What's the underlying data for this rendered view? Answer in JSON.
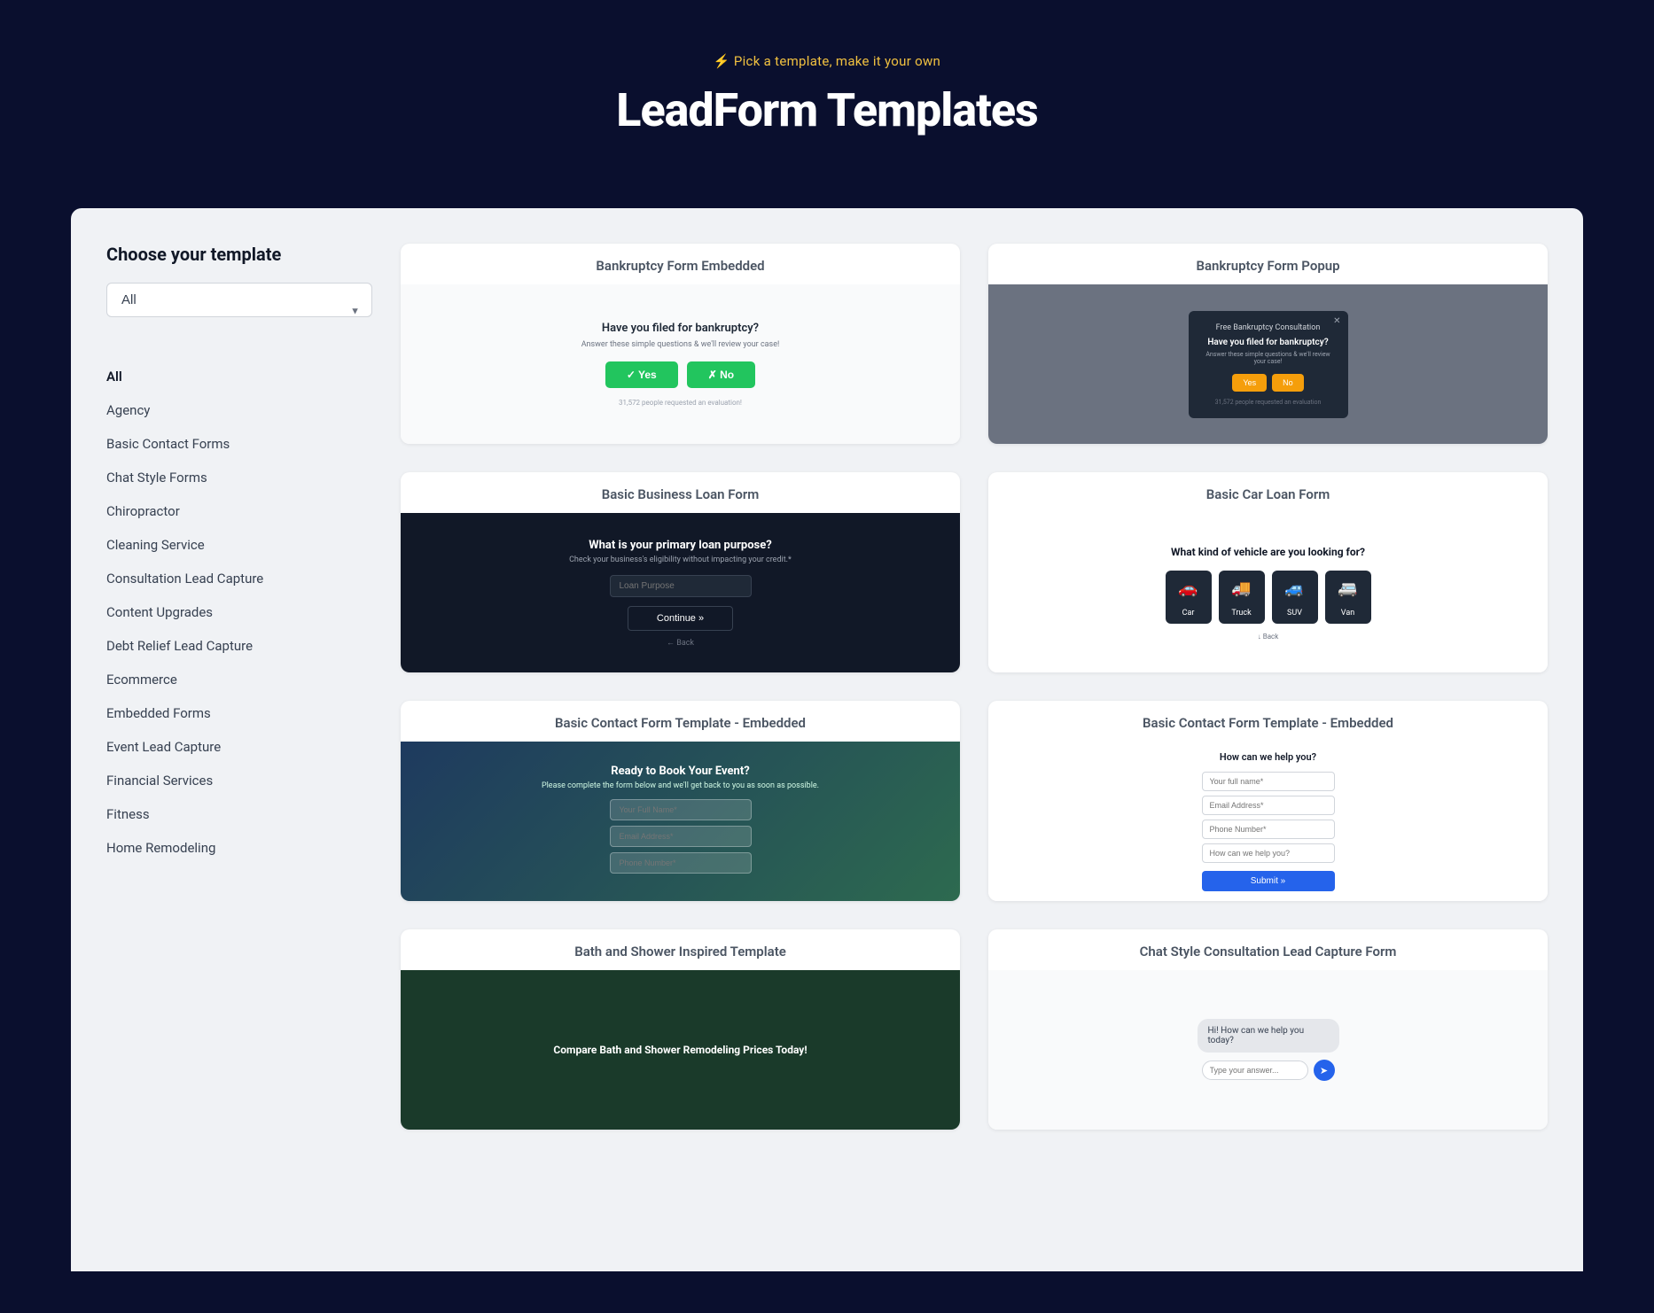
{
  "hero": {
    "subtitle": "⚡ Pick a template, make it your own",
    "title": "LeadForm Templates"
  },
  "sidebar": {
    "title": "Choose your template",
    "dropdown": {
      "value": "All",
      "options": [
        "All",
        "Agency",
        "Basic Contact Forms",
        "Chat Style Forms",
        "Chiropractor",
        "Cleaning Service",
        "Consultation Lead Capture",
        "Content Upgrades",
        "Debt Relief Lead Capture",
        "Ecommerce",
        "Embedded Forms",
        "Event Lead Capture",
        "Financial Services",
        "Fitness",
        "Home Remodeling"
      ]
    },
    "nav_items": [
      {
        "label": "All",
        "active": true
      },
      {
        "label": "Agency",
        "active": false
      },
      {
        "label": "Basic Contact Forms",
        "active": false
      },
      {
        "label": "Chat Style Forms",
        "active": false
      },
      {
        "label": "Chiropractor",
        "active": false
      },
      {
        "label": "Cleaning Service",
        "active": false
      },
      {
        "label": "Consultation Lead Capture",
        "active": false
      },
      {
        "label": "Content Upgrades",
        "active": false
      },
      {
        "label": "Debt Relief Lead Capture",
        "active": false
      },
      {
        "label": "Ecommerce",
        "active": false
      },
      {
        "label": "Embedded Forms",
        "active": false
      },
      {
        "label": "Event Lead Capture",
        "active": false
      },
      {
        "label": "Financial Services",
        "active": false
      },
      {
        "label": "Fitness",
        "active": false
      },
      {
        "label": "Home Remodeling",
        "active": false
      }
    ]
  },
  "templates": [
    {
      "id": "bankruptcy-embedded",
      "title": "Bankruptcy Form Embedded",
      "preview_type": "bankruptcy-embedded",
      "preview_data": {
        "question": "Have you filed for bankruptcy?",
        "subtitle": "Answer these simple questions & we'll review your case!",
        "btn_yes": "Yes",
        "btn_no": "No",
        "stat": "31,572 people requested an evaluation!"
      }
    },
    {
      "id": "bankruptcy-popup",
      "title": "Bankruptcy Form Popup",
      "preview_type": "bankruptcy-popup",
      "preview_data": {
        "header": "Free Bankruptcy Consultation",
        "question": "Have you filed for bankruptcy?",
        "subtitle": "Answer these simple questions & we'll review your case!",
        "btn_yes": "Yes",
        "btn_no": "No",
        "stat": "31,572 people requested an evaluation"
      }
    },
    {
      "id": "basic-business-loan",
      "title": "Basic Business Loan Form",
      "preview_type": "business-loan",
      "preview_data": {
        "question": "What is your primary loan purpose?",
        "subtitle": "Check your business's eligibility without impacting your credit.*",
        "placeholder": "Loan Purpose",
        "btn": "Continue »",
        "back": "← Back"
      }
    },
    {
      "id": "basic-car-loan",
      "title": "Basic Car Loan Form",
      "preview_type": "car-loan",
      "preview_data": {
        "question": "What kind of vehicle are you looking for?",
        "options": [
          "Car",
          "Truck",
          "SUV",
          "Van"
        ],
        "icons": [
          "🚗",
          "🚚",
          "🚙",
          "🚐"
        ],
        "more": "↓ Back"
      }
    },
    {
      "id": "basic-contact-embedded",
      "title": "Basic Contact Form Template - Embedded",
      "preview_type": "contact-event",
      "preview_data": {
        "question": "Ready to Book Your Event?",
        "subtitle": "Please complete the form below and we'll get back to you as soon as possible.",
        "fields": [
          "Your Full Name*",
          "Email Address*",
          "Phone Number*"
        ]
      }
    },
    {
      "id": "basic-contact-embedded-2",
      "title": "Basic Contact Form Template - Embedded",
      "preview_type": "contact-white",
      "preview_data": {
        "question": "How can we help you?",
        "fields": [
          "Your full name*",
          "Email Address*",
          "Phone Number*",
          "How can we help you?"
        ],
        "btn": "Submit »"
      }
    },
    {
      "id": "bath-shower",
      "title": "Bath and Shower Inspired Template",
      "preview_type": "bath",
      "preview_data": {
        "question": "Compare Bath and Shower Remodeling Prices Today!"
      }
    },
    {
      "id": "chat-consultation",
      "title": "Chat Style Consultation Lead Capture Form",
      "preview_type": "chat",
      "preview_data": {
        "bubble": "Hi! How can we help you today?",
        "placeholder": "Type your answer..."
      }
    }
  ]
}
